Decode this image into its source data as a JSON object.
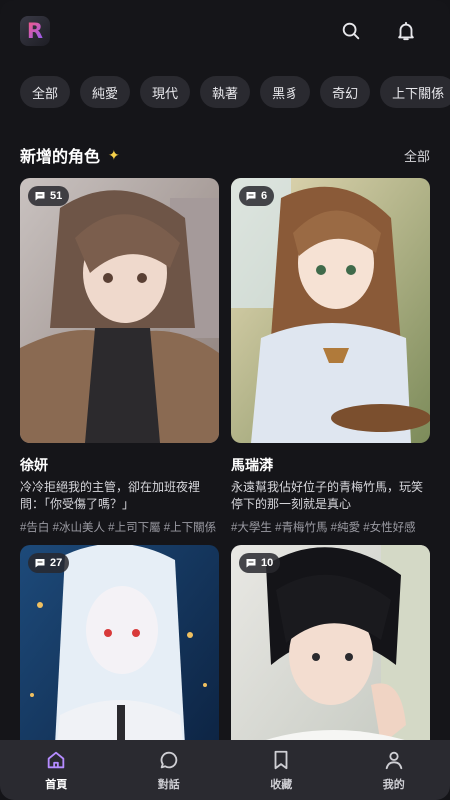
{
  "header": {
    "logo_letter": "R",
    "search_icon": "search-icon",
    "notification_icon": "bell-icon"
  },
  "chips": [
    "全部",
    "純愛",
    "現代",
    "執著",
    "黑豸",
    "奇幻",
    "上下關係"
  ],
  "section": {
    "title": "新增的角色",
    "title_icon": "sparkle-icon",
    "see_all": "全部"
  },
  "cards": [
    {
      "count": "51",
      "name": "徐妍",
      "desc": "冷冷拒絕我的主管，卻在加班夜裡問：「你受傷了嗎？」",
      "tags": "#告白 #冰山美人 #上司下屬 #上下關係"
    },
    {
      "count": "6",
      "name": "馬瑞漭",
      "desc": "永遠幫我佔好位子的青梅竹馬，玩笑停下的那一刻就是真心",
      "tags": "#大學生 #青梅竹馬 #純愛 #女性好感"
    },
    {
      "count": "27",
      "name": "",
      "desc": "",
      "tags": ""
    },
    {
      "count": "10",
      "name": "",
      "desc": "",
      "tags": ""
    }
  ],
  "nav": [
    {
      "label": "首頁",
      "icon": "home-icon",
      "active": true
    },
    {
      "label": "對話",
      "icon": "chat-icon",
      "active": false
    },
    {
      "label": "收藏",
      "icon": "bookmark-icon",
      "active": false
    },
    {
      "label": "我的",
      "icon": "profile-icon",
      "active": false
    }
  ],
  "colors": {
    "background": "#151519",
    "chip_bg": "#2a2a30",
    "nav_bg": "#2a2a30",
    "active_nav": "#b58cff",
    "sparkle": "#f7d14a"
  }
}
